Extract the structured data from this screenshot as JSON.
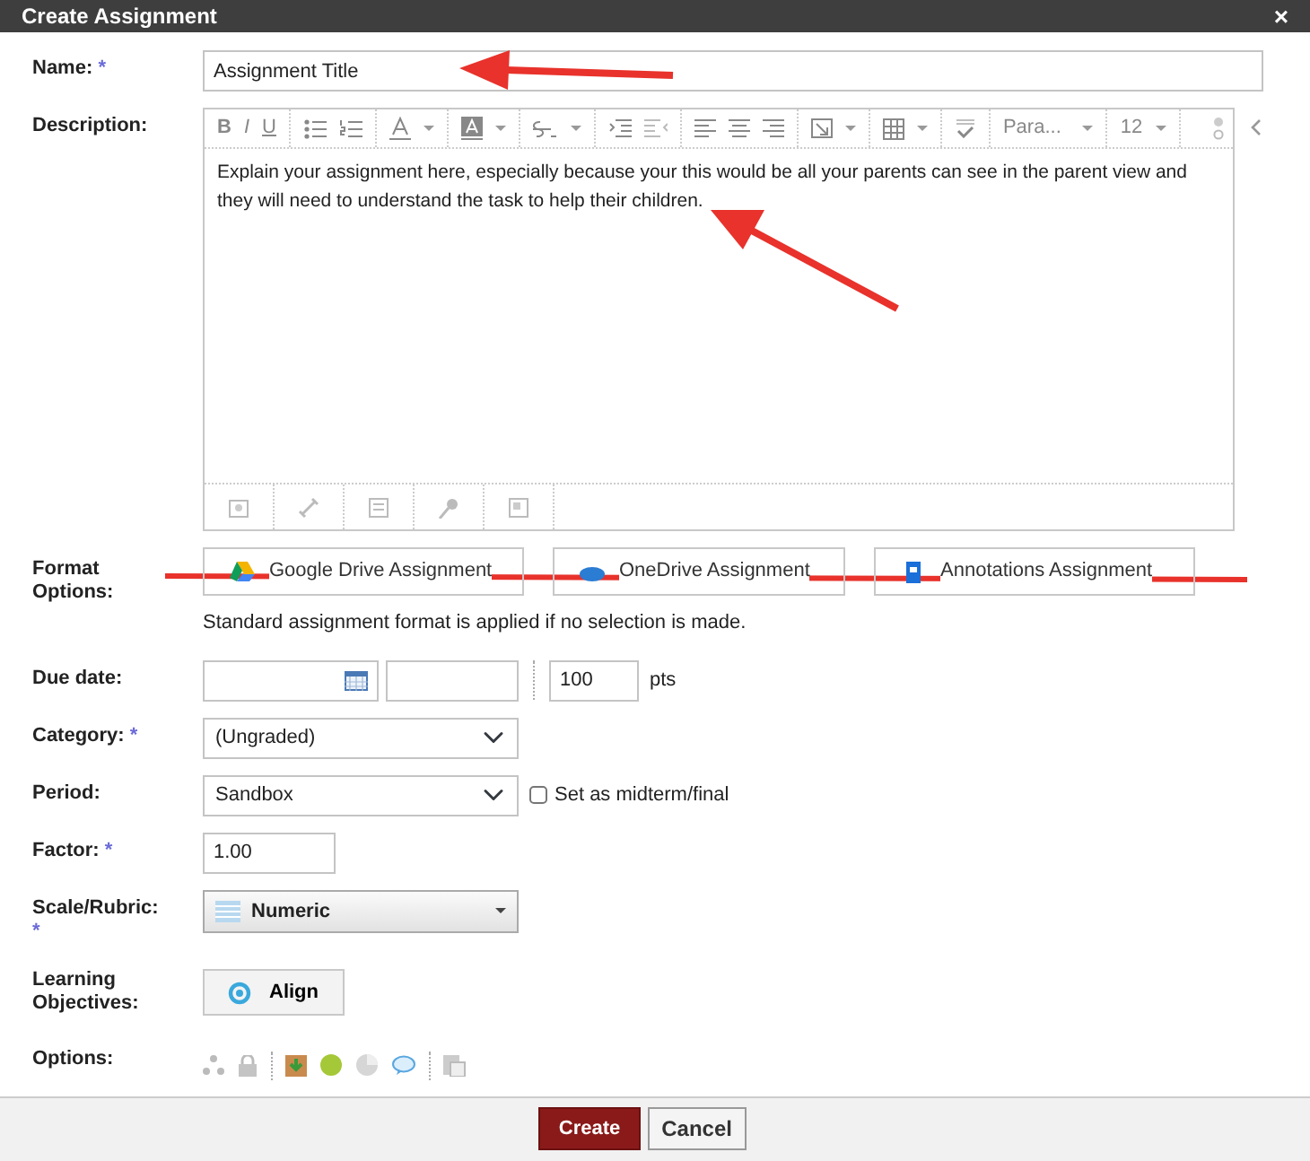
{
  "dialog": {
    "title": "Create Assignment",
    "close": "×"
  },
  "name": {
    "label": "Name:",
    "required_mark": "*",
    "value": "Assignment Title"
  },
  "description": {
    "label": "Description:",
    "bold": "B",
    "italic": "I",
    "underline": "U",
    "paragraph": "Para...",
    "font_size": "12",
    "text": "Explain your assignment here, especially because your this would be all your parents can see in the parent view and they will need to understand the task to help their children."
  },
  "format_options": {
    "label": "Format Options:",
    "buttons": [
      "Google Drive Assignment",
      "OneDrive Assignment",
      "Annotations Assignment"
    ],
    "note": "Standard assignment format is applied if no selection is made."
  },
  "due_date": {
    "label": "Due date:",
    "points": "100",
    "points_unit": "pts"
  },
  "category": {
    "label": "Category:",
    "required_mark": "*",
    "value": "(Ungraded)"
  },
  "period": {
    "label": "Period:",
    "value": "Sandbox",
    "midterm": {
      "label": "Set as midterm/final",
      "checked": false
    }
  },
  "factor": {
    "label": "Factor:",
    "required_mark": "*",
    "value": "1.00"
  },
  "scale": {
    "label": "Scale/Rubric:",
    "required_mark": "*",
    "value": "Numeric"
  },
  "learning_objectives": {
    "label": "Learning Objectives:",
    "button": "Align"
  },
  "options": {
    "label": "Options:"
  },
  "footer": {
    "buttons": [
      {
        "label": "Create",
        "kind": "primary"
      },
      {
        "label": "Cancel",
        "kind": "secondary"
      }
    ]
  }
}
